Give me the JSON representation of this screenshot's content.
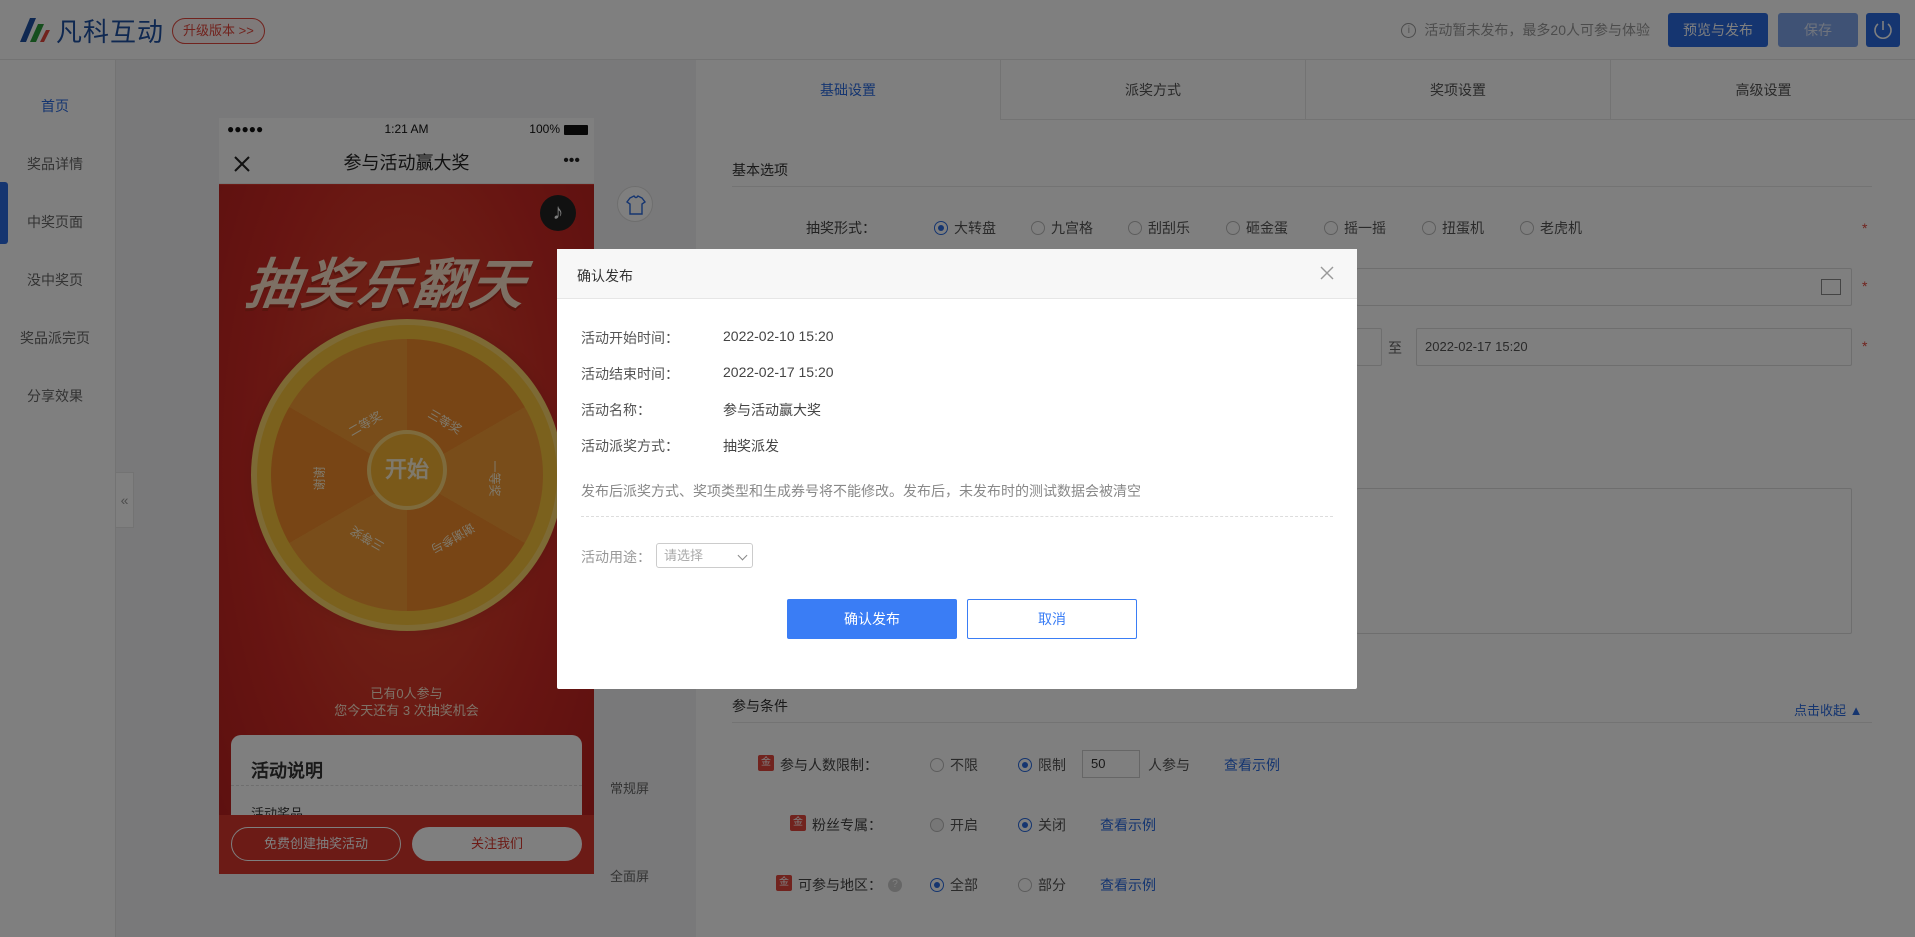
{
  "header": {
    "logo_text": "凡科互动",
    "upgrade_label": "升级版本 >>",
    "info_text": "活动暂未发布，最多20人可参与体验",
    "preview_publish_label": "预览与发布",
    "save_label": "保存"
  },
  "leftnav": {
    "items": [
      {
        "label": "首页"
      },
      {
        "label": "奖品详情"
      },
      {
        "label": "中奖页面"
      },
      {
        "label": "没中奖页"
      },
      {
        "label": "奖品派完页"
      },
      {
        "label": "分享效果"
      }
    ],
    "collapse_label": "«"
  },
  "phone": {
    "signal": "●●●●●",
    "time": "1:21 AM",
    "battery": "100%",
    "title": "参与活动赢大奖",
    "more": "•••",
    "banner": "抽奖乐翻天",
    "wheel_labels": [
      "二等奖",
      "三等奖",
      "一等奖",
      "谢谢参与",
      "三等奖",
      "谢谢"
    ],
    "wheel_center": "开始",
    "stat_line1": "已有0人参与",
    "stat_line2": "您今天还有 3 次抽奖机会",
    "card_title": "活动说明",
    "card_sub": "活动奖品",
    "btn_create": "免费创建抽奖活动",
    "btn_follow": "关注我们"
  },
  "screen_modes": {
    "normal": "常规屏",
    "full": "全面屏"
  },
  "tabs": [
    {
      "label": "基础设置"
    },
    {
      "label": "派奖方式"
    },
    {
      "label": "奖项设置"
    },
    {
      "label": "高级设置"
    }
  ],
  "form": {
    "section_basic": "基本选项",
    "draw_type_label": "抽奖形式：",
    "draw_types": [
      {
        "label": "大转盘",
        "selected": true
      },
      {
        "label": "九宫格",
        "selected": false
      },
      {
        "label": "刮刮乐",
        "selected": false
      },
      {
        "label": "砸金蛋",
        "selected": false
      },
      {
        "label": "摇一摇",
        "selected": false
      },
      {
        "label": "扭蛋机",
        "selected": false
      },
      {
        "label": "老虎机",
        "selected": false
      }
    ],
    "to_label": "至",
    "end_time": "2022-02-17 15:20",
    "section_conditions": "参与条件",
    "collapse_link": "点击收起 ▲",
    "participant_limit_label": "参与人数限制：",
    "limit_options": [
      {
        "label": "不限",
        "selected": false
      },
      {
        "label": "限制",
        "selected": true
      }
    ],
    "limit_value": "50",
    "limit_unit": "人参与",
    "fan_only_label": "粉丝专属：",
    "fan_options": [
      {
        "label": "开启",
        "selected": false
      },
      {
        "label": "关闭",
        "selected": true
      }
    ],
    "region_label": "可参与地区：",
    "region_options": [
      {
        "label": "全部",
        "selected": true
      },
      {
        "label": "部分",
        "selected": false
      }
    ],
    "view_example": "查看示例",
    "cond_icon": "金"
  },
  "modal": {
    "title": "确认发布",
    "rows": [
      {
        "label": "活动开始时间：",
        "value": "2022-02-10 15:20"
      },
      {
        "label": "活动结束时间：",
        "value": "2022-02-17 15:20"
      },
      {
        "label": "活动名称：",
        "value": "参与活动赢大奖"
      },
      {
        "label": "活动派奖方式：",
        "value": "抽奖派发"
      }
    ],
    "note": "发布后派奖方式、奖项类型和生成券号将不能修改。发布后，未发布时的测试数据会被清空",
    "purpose_label": "活动用途：",
    "purpose_placeholder": "请选择",
    "confirm_label": "确认发布",
    "cancel_label": "取消"
  },
  "colors": {
    "primary": "#2a6be0",
    "confirm_button": "#3a7df5",
    "danger": "#e2463c",
    "phone_red": "#d9372c"
  }
}
